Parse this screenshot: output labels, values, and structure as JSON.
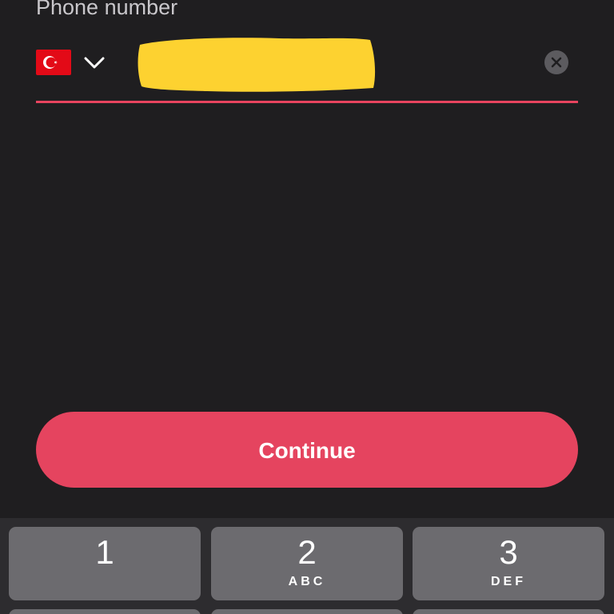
{
  "phone_field": {
    "label": "Phone number",
    "country_flag": "turkey-flag",
    "value": "",
    "clear_icon": "close-icon",
    "underline_color": "#e8445f"
  },
  "continue_button": {
    "label": "Continue",
    "color": "#e5445f"
  },
  "keypad": {
    "keys": [
      {
        "digit": "1",
        "letters": ""
      },
      {
        "digit": "2",
        "letters": "ABC"
      },
      {
        "digit": "3",
        "letters": "DEF"
      }
    ]
  }
}
